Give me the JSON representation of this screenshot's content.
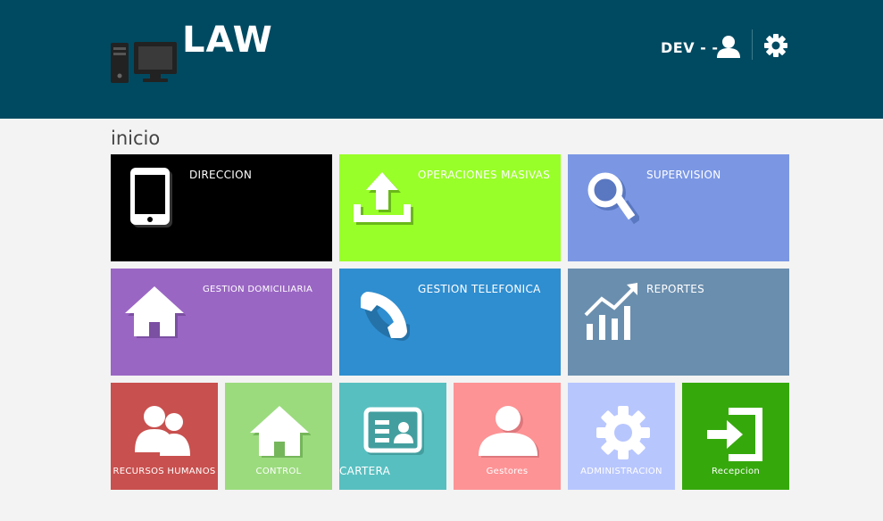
{
  "header": {
    "title": "LAW",
    "user_name": "DEV - -",
    "background": "#004a61"
  },
  "page": {
    "heading": "inicio"
  },
  "tiles": {
    "direccion": {
      "label": "DIRECCION",
      "color": "#000000",
      "icon": "tablet-icon"
    },
    "operaciones": {
      "label": "OPERACIONES MASIVAS",
      "color": "#99ff28",
      "icon": "upload-icon"
    },
    "supervision": {
      "label": "SUPERVISION",
      "color": "#7b97e4",
      "icon": "search-icon"
    },
    "gestion_domiciliaria": {
      "label": "GESTION DOMICILIARIA",
      "color": "#9a66c4",
      "icon": "home-icon"
    },
    "gestion_telefonica": {
      "label": "GESTION TELEFONICA",
      "color": "#2f8ed0",
      "icon": "phone-icon"
    },
    "reportes": {
      "label": "REPORTES",
      "color": "#6a8eae",
      "icon": "chart-growth-icon"
    },
    "recursos_humanos": {
      "label": "RECURSOS HUMANOS",
      "color": "#c8504e",
      "icon": "users-icon"
    },
    "control": {
      "label": "CONTROL",
      "color": "#9bdb7e",
      "icon": "home-icon"
    },
    "cartera": {
      "label": "CARTERA",
      "color": "#58bfc0",
      "icon": "id-card-icon"
    },
    "gestores": {
      "label": "Gestores",
      "color": "#fd9395",
      "icon": "user-icon"
    },
    "administracion": {
      "label": "ADMINISTRACION",
      "color": "#b8c6fe",
      "icon": "gear-icon"
    },
    "recepcion": {
      "label": "Recepcion",
      "color": "#35a90c",
      "icon": "sign-in-icon"
    }
  }
}
